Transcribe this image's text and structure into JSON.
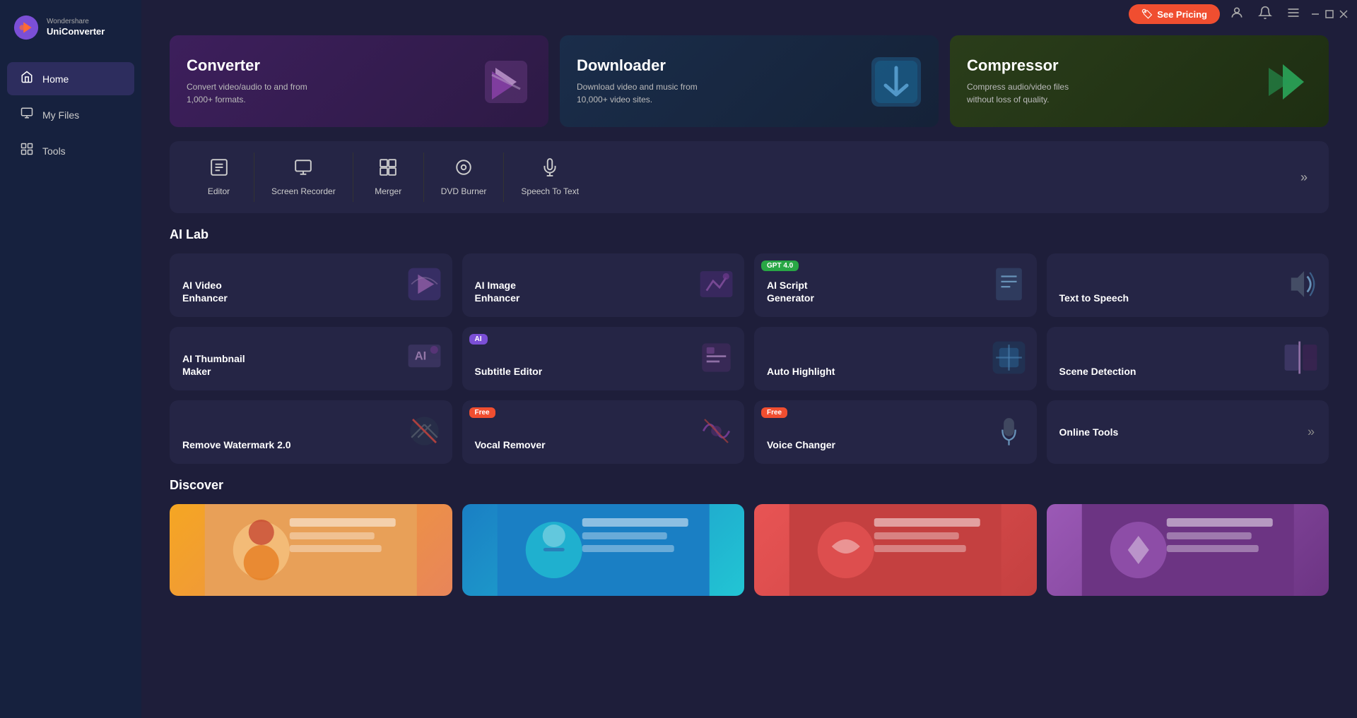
{
  "app": {
    "brand": "Wondershare",
    "product": "UniConverter"
  },
  "titlebar": {
    "see_pricing": "See Pricing",
    "minimize": "—",
    "maximize": "□",
    "close": "✕"
  },
  "sidebar": {
    "items": [
      {
        "id": "home",
        "label": "Home",
        "icon": "⌂",
        "active": true
      },
      {
        "id": "my-files",
        "label": "My Files",
        "icon": "📁",
        "active": false
      },
      {
        "id": "tools",
        "label": "Tools",
        "icon": "🔧",
        "active": false
      }
    ]
  },
  "hero_cards": [
    {
      "id": "converter",
      "title": "Converter",
      "description": "Convert video/audio to and from 1,000+ formats.",
      "icon": "🔀",
      "theme": "converter"
    },
    {
      "id": "downloader",
      "title": "Downloader",
      "description": "Download video and music from 10,000+ video sites.",
      "icon": "⬇",
      "theme": "downloader"
    },
    {
      "id": "compressor",
      "title": "Compressor",
      "description": "Compress audio/video files without loss of quality.",
      "icon": "▶",
      "theme": "compressor"
    }
  ],
  "toolbar": {
    "items": [
      {
        "id": "editor",
        "label": "Editor",
        "icon": "✂"
      },
      {
        "id": "screen-recorder",
        "label": "Screen Recorder",
        "icon": "🖥"
      },
      {
        "id": "merger",
        "label": "Merger",
        "icon": "⊞"
      },
      {
        "id": "dvd-burner",
        "label": "DVD Burner",
        "icon": "💿"
      },
      {
        "id": "speech-to-text",
        "label": "Speech To Text",
        "icon": "🎙"
      }
    ],
    "more_icon": "»"
  },
  "ai_lab": {
    "title": "AI Lab",
    "cards": [
      {
        "id": "ai-video-enhancer",
        "label": "AI Video Enhancer",
        "icon": "🎬",
        "badge": null
      },
      {
        "id": "ai-image-enhancer",
        "label": "AI Image Enhancer",
        "icon": "🖼",
        "badge": null
      },
      {
        "id": "ai-script-generator",
        "label": "AI Script Generator",
        "icon": "📋",
        "badge": "GPT 4.0",
        "badge_type": "gpt"
      },
      {
        "id": "text-to-speech",
        "label": "Text to Speech",
        "icon": "🔊",
        "badge": null
      },
      {
        "id": "ai-thumbnail-maker",
        "label": "AI Thumbnail Maker",
        "icon": "🏷",
        "badge": null
      },
      {
        "id": "subtitle-editor",
        "label": "Subtitle Editor",
        "icon": "📝",
        "badge": "AI",
        "badge_type": "ai"
      },
      {
        "id": "auto-highlight",
        "label": "Auto Highlight",
        "icon": "✨",
        "badge": null
      },
      {
        "id": "scene-detection",
        "label": "Scene Detection",
        "icon": "🎞",
        "badge": null
      },
      {
        "id": "remove-watermark",
        "label": "Remove Watermark 2.0",
        "icon": "💧",
        "badge": null
      },
      {
        "id": "vocal-remover",
        "label": "Vocal Remover",
        "icon": "🎵",
        "badge": "Free",
        "badge_type": "free"
      },
      {
        "id": "voice-changer",
        "label": "Voice Changer",
        "icon": "🎤",
        "badge": "Free",
        "badge_type": "free"
      },
      {
        "id": "online-tools",
        "label": "Online Tools",
        "icon": "»",
        "badge": null,
        "is_more": true
      }
    ]
  },
  "discover": {
    "title": "Discover",
    "cards": [
      {
        "id": "discover-1",
        "icon": "👩"
      },
      {
        "id": "discover-2",
        "icon": "🕶"
      },
      {
        "id": "discover-3",
        "icon": "🎶"
      },
      {
        "id": "discover-4",
        "icon": "🎉"
      }
    ]
  }
}
